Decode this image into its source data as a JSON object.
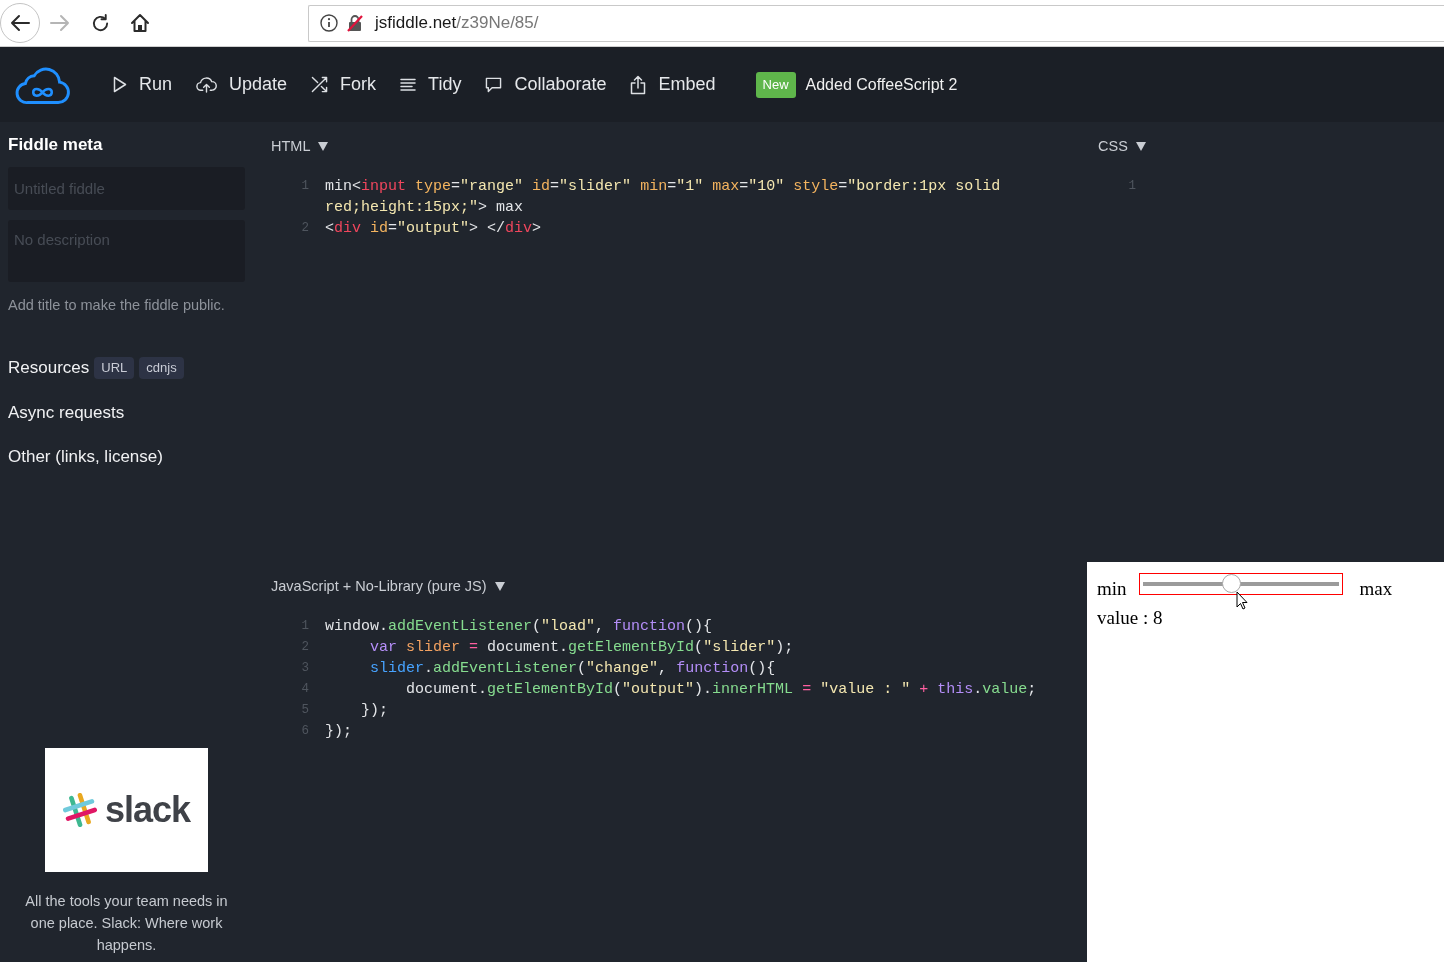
{
  "browser": {
    "buttons": [
      {
        "kind": "back",
        "disabled": false
      },
      {
        "kind": "forward",
        "disabled": true
      },
      {
        "kind": "reload",
        "disabled": false
      },
      {
        "kind": "home",
        "disabled": false
      }
    ],
    "address": {
      "host": "jsfiddle.net",
      "path": "/z39Ne/85/"
    }
  },
  "header": {
    "actions": [
      {
        "kind": "run",
        "label": "Run"
      },
      {
        "kind": "update",
        "label": "Update"
      },
      {
        "kind": "fork",
        "label": "Fork"
      },
      {
        "kind": "tidy",
        "label": "Tidy"
      },
      {
        "kind": "collaborate",
        "label": "Collaborate"
      },
      {
        "kind": "embed",
        "label": "Embed"
      }
    ],
    "news": {
      "badge": "New",
      "text": "Added CoffeeScript 2"
    }
  },
  "sidebar": {
    "title": "Fiddle meta",
    "title_field": {
      "placeholder": "Untitled fiddle"
    },
    "description_field": {
      "placeholder": "No description"
    },
    "hint": "Add title to make the fiddle public.",
    "sections": [
      {
        "label": "Resources",
        "badges": [
          "URL",
          "cdnjs"
        ]
      },
      {
        "label": "Async requests"
      },
      {
        "label": "Other (links, license)"
      }
    ],
    "ad": {
      "logo_text": "slack",
      "text": "All the tools your team needs in one place. Slack: Where work happens."
    }
  },
  "panels": [
    {
      "kind": "editor",
      "title": "HTML",
      "lines": [
        {
          "number": "1",
          "tokens": [
            {
              "kind": "plain",
              "text": "min<"
            },
            {
              "kind": "tag",
              "text": "input"
            },
            {
              "kind": "attr",
              "text": " type"
            },
            {
              "kind": "plain",
              "text": "="
            },
            {
              "kind": "string",
              "text": "\"range\""
            },
            {
              "kind": "attr",
              "text": " id"
            },
            {
              "kind": "plain",
              "text": "="
            },
            {
              "kind": "string",
              "text": "\"slider\""
            },
            {
              "kind": "attr",
              "text": " min"
            },
            {
              "kind": "plain",
              "text": "="
            },
            {
              "kind": "string",
              "text": "\"1\""
            },
            {
              "kind": "attr",
              "text": " max"
            },
            {
              "kind": "plain",
              "text": "="
            },
            {
              "kind": "string",
              "text": "\"10\""
            },
            {
              "kind": "attr",
              "text": " style"
            },
            {
              "kind": "plain",
              "text": "="
            },
            {
              "kind": "string",
              "text": "\"border:1px solid red;height:15px;\""
            },
            {
              "kind": "plain",
              "text": "> max"
            }
          ]
        },
        {
          "number": "2",
          "tokens": [
            {
              "kind": "plain",
              "text": "<"
            },
            {
              "kind": "tag",
              "text": "div"
            },
            {
              "kind": "attr",
              "text": " id"
            },
            {
              "kind": "plain",
              "text": "="
            },
            {
              "kind": "string",
              "text": "\"output\""
            },
            {
              "kind": "plain",
              "text": "> </"
            },
            {
              "kind": "tag",
              "text": "div"
            },
            {
              "kind": "plain",
              "text": ">"
            }
          ]
        }
      ]
    },
    {
      "kind": "editor",
      "title": "CSS",
      "lines": [
        {
          "number": "1"
        }
      ]
    },
    {
      "kind": "editor",
      "title": "JavaScript + No-Library (pure JS)",
      "lines": [
        {
          "number": "1",
          "tokens": [
            {
              "kind": "plain",
              "text": "window."
            },
            {
              "kind": "prop",
              "text": "addEventListener"
            },
            {
              "kind": "plain",
              "text": "("
            },
            {
              "kind": "string",
              "text": "\"load\""
            },
            {
              "kind": "plain",
              "text": ", "
            },
            {
              "kind": "keyword",
              "text": "function"
            },
            {
              "kind": "plain",
              "text": "(){"
            }
          ]
        },
        {
          "number": "2",
          "tokens": [
            {
              "kind": "keyword",
              "text": "     var"
            },
            {
              "kind": "definition",
              "text": " slider"
            },
            {
              "kind": "operator",
              "text": " ="
            },
            {
              "kind": "plain",
              "text": " document."
            },
            {
              "kind": "prop",
              "text": "getElementById"
            },
            {
              "kind": "plain",
              "text": "("
            },
            {
              "kind": "string",
              "text": "\"slider\""
            },
            {
              "kind": "plain",
              "text": ");"
            }
          ]
        },
        {
          "number": "3",
          "tokens": [
            {
              "kind": "variable",
              "text": "     slider"
            },
            {
              "kind": "plain",
              "text": "."
            },
            {
              "kind": "prop",
              "text": "addEventListener"
            },
            {
              "kind": "plain",
              "text": "("
            },
            {
              "kind": "string",
              "text": "\"change\""
            },
            {
              "kind": "plain",
              "text": ", "
            },
            {
              "kind": "keyword",
              "text": "function"
            },
            {
              "kind": "plain",
              "text": "(){"
            }
          ]
        },
        {
          "number": "4",
          "tokens": [
            {
              "kind": "plain",
              "text": "         document."
            },
            {
              "kind": "prop",
              "text": "getElementById"
            },
            {
              "kind": "plain",
              "text": "("
            },
            {
              "kind": "string",
              "text": "\"output\""
            },
            {
              "kind": "plain",
              "text": ")."
            },
            {
              "kind": "prop",
              "text": "innerHTML"
            },
            {
              "kind": "operator",
              "text": " ="
            },
            {
              "kind": "string",
              "text": " \"value : \""
            },
            {
              "kind": "operator",
              "text": " +"
            },
            {
              "kind": "keyword",
              "text": " this"
            },
            {
              "kind": "plain",
              "text": "."
            },
            {
              "kind": "prop",
              "text": "value"
            },
            {
              "kind": "plain",
              "text": ";"
            }
          ]
        },
        {
          "number": "5",
          "tokens": [
            {
              "kind": "plain",
              "text": "    });"
            }
          ]
        },
        {
          "number": "6",
          "tokens": [
            {
              "kind": "plain",
              "text": "});"
            }
          ]
        }
      ]
    },
    {
      "kind": "result",
      "min_label": "min",
      "max_label": "max",
      "slider": {
        "level": 0.45
      },
      "output": "value : 8"
    }
  ]
}
